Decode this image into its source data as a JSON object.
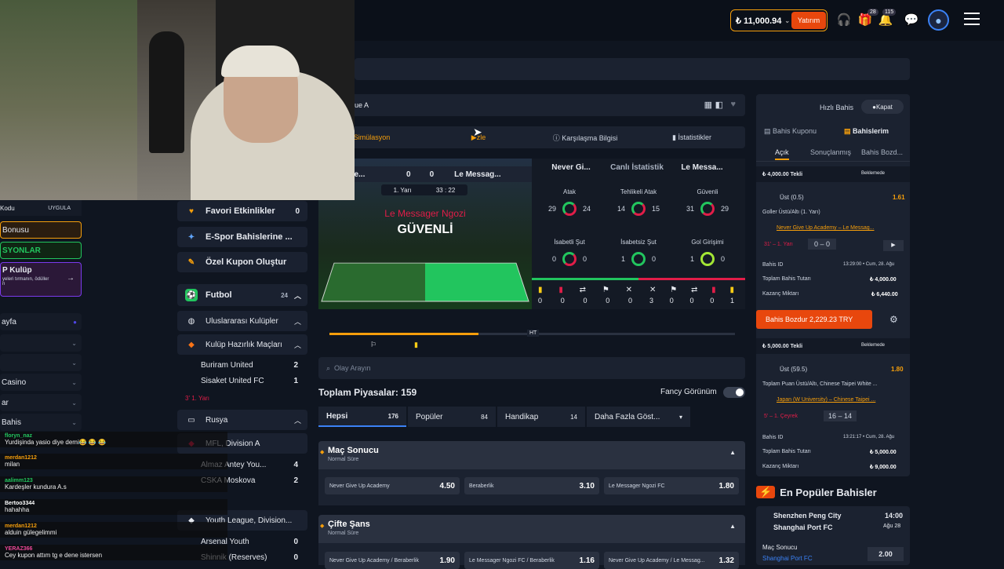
{
  "header": {
    "balance": "₺ 11,000.94",
    "deposit_label": "Yatırım",
    "gift_badge": "28",
    "notif_badge": "115"
  },
  "left_sidebar": {
    "promo_code_label": "Kodu",
    "apply_label": "UYGULA",
    "bonus_label": "Bonusu",
    "promotions_label": "SYONLAR",
    "vip_title": "P Kulüp",
    "vip_sub": "yeleri tırmanın, ödüller",
    "vip_sub2": "n",
    "items": [
      "ayfa",
      "",
      "",
      "Casino",
      "ar",
      "Bahis"
    ]
  },
  "chat": [
    {
      "user": "floryn_naz",
      "msg": "Yurdişinda yasio diye demi😂 😂 😂",
      "color": "#22c55e"
    },
    {
      "user": "merdan1212",
      "msg": "milan",
      "color": "#f59e0b"
    },
    {
      "user": "aalimm123",
      "msg": "Kardeşler kundura A.s",
      "color": "#22c55e"
    },
    {
      "user": "Bertoo3344",
      "msg": "hahahha",
      "color": "#ffffff"
    },
    {
      "user": "merdan1212",
      "msg": "alduin gülegelimmi",
      "color": "#f59e0b"
    },
    {
      "user": "YERAZ366",
      "msg": "Cey kupon attım tg e dene istersen",
      "color": "#ec4899"
    }
  ],
  "mid_sidebar": {
    "favorites": {
      "label": "Favori Etkinlikler",
      "count": "0"
    },
    "esports": {
      "label": "E-Spor Bahislerine ..."
    },
    "custom_coupon": {
      "label": "Özel Kupon Oluştur"
    },
    "football": {
      "label": "Futbol",
      "count": "24"
    },
    "international": {
      "label": "Uluslararası Kulüpler"
    },
    "friendly": {
      "label": "Kulüp Hazırlık Maçları"
    },
    "matches1": [
      {
        "name": "Buriram United",
        "count": "2"
      },
      {
        "name": "Sisaket United FC",
        "count": "1"
      }
    ],
    "live1": "3' 1. Yarı",
    "russia": {
      "label": "Rusya"
    },
    "division": {
      "label": "MFL, Division A"
    },
    "matches2": [
      {
        "name": "Almaz Antey You...",
        "count": "4"
      },
      {
        "name": "CSKA Moskova",
        "count": "2"
      }
    ],
    "youth": {
      "label": "Youth League, Division..."
    },
    "matches3": [
      {
        "name": "Arsenal Youth",
        "count": "0"
      },
      {
        "name": "Shinnik (Reserves)",
        "count": "0"
      }
    ]
  },
  "event": {
    "league": "ue A",
    "tabs": [
      "Simülasyon",
      "zle",
      "Karşılaşma Bilgisi",
      "İstatistikler"
    ],
    "home_short": "r Give...",
    "away_short": "Le Messag...",
    "home_score": "0",
    "away_score": "0",
    "period": "1. Yarı",
    "clock": "33 : 22",
    "attack_team": "Le Messager Ngozi",
    "attack_state": "GÜVENLİ",
    "stats_home": "Never Gi...",
    "stats_label": "Canlı İstatistik",
    "stats_away": "Le Messa...",
    "stats": [
      {
        "label": "Atak",
        "home": "29",
        "away": "24"
      },
      {
        "label": "Tehlikeli Atak",
        "home": "14",
        "away": "15"
      },
      {
        "label": "Güvenli",
        "home": "31",
        "away": "29"
      },
      {
        "label": "İsabetli Şut",
        "home": "0",
        "away": "0"
      },
      {
        "label": "İsabetsiz Şut",
        "home": "1",
        "away": "0"
      },
      {
        "label": "Gol Girişimi",
        "home": "1",
        "away": "0"
      }
    ],
    "cards_home": [
      "0",
      "0",
      "0",
      "0",
      "0"
    ],
    "cards_away": [
      "3",
      "0",
      "0",
      "0",
      "1"
    ],
    "timeline_ht": "HT",
    "search_placeholder": "Olay Arayın"
  },
  "markets": {
    "total_label": "Toplam Piyasalar:",
    "total_count": "159",
    "fancy_label": "Fancy Görünüm",
    "tabs": [
      {
        "label": "Hepsi",
        "count": "176"
      },
      {
        "label": "Popüler",
        "count": "84"
      },
      {
        "label": "Handikap",
        "count": "14"
      },
      {
        "label": "Daha Fazla Göst...",
        "count": ""
      }
    ],
    "match_result": {
      "title": "Maç Sonucu",
      "sub": "Normal Süre",
      "odds": [
        {
          "label": "Never Give Up Academy",
          "value": "4.50"
        },
        {
          "label": "Beraberlik",
          "value": "3.10"
        },
        {
          "label": "Le Messager Ngozi FC",
          "value": "1.80"
        }
      ]
    },
    "double_chance": {
      "title": "Çifte Şans",
      "sub": "Normal Süre",
      "odds": [
        {
          "label": "Never Give Up Academy / Beraberlik",
          "value": "1.90"
        },
        {
          "label": "Le Messager Ngozi FC / Beraberlik",
          "value": "1.16"
        },
        {
          "label": "Never Give Up Academy / Le Messag...",
          "value": "1.32"
        }
      ]
    }
  },
  "betslip": {
    "quick_bet": "Hızlı Bahis",
    "close": "Kapat",
    "tab_coupon": "Bahis Kuponu",
    "tab_mybets": "Bahislerim",
    "sub_open": "Açık",
    "sub_settled": "Sonuçlanmış",
    "sub_builder": "Bahis Bozd...",
    "bet1": {
      "stake_type": "₺ 4,000.00 Tekli",
      "status": "Beklemede",
      "selection": "Üst (0.5)",
      "odds": "1.61",
      "market": "Goller Üstü/Altı (1. Yarı)",
      "event": "Never Give Up Academy – Le Messag...",
      "live": "31' – 1. Yarı",
      "score": "0 – 0",
      "id_label": "Bahis ID",
      "time": "13:29:00 • Cum, 28. Ağu",
      "stake_label": "Toplam Bahis Tutarı",
      "stake": "₺ 4,000.00",
      "win_label": "Kazanç Miktarı",
      "win": "₺ 6,440.00",
      "cashout": "Bahis Bozdur 2,229.23 TRY"
    },
    "bet2": {
      "stake_type": "₺ 5,000.00 Tekli",
      "status": "Beklemede",
      "selection": "Üst (59.5)",
      "odds": "1.80",
      "market": "Toplam Puan Üstü/Altı, Chinese Taipei White ...",
      "event": "Japan (W University) – Chinese Taipei ...",
      "live": "5' – 1. Çeyrek",
      "score": "16 – 14",
      "id_label": "Bahis ID",
      "time": "13:21:17 • Cum, 28. Ağu",
      "stake_label": "Toplam Bahis Tutarı",
      "stake": "₺ 5,000.00",
      "win_label": "Kazanç Miktarı",
      "win": "₺ 9,000.00"
    }
  },
  "popular": {
    "title": "En Popüler Bahisler",
    "home": "Shenzhen Peng City",
    "away": "Shanghai Port FC",
    "time": "14:00",
    "date": "Ağu 28",
    "market": "Maç Sonucu",
    "selection": "Shanghai Port FC",
    "odds": "2.00"
  }
}
